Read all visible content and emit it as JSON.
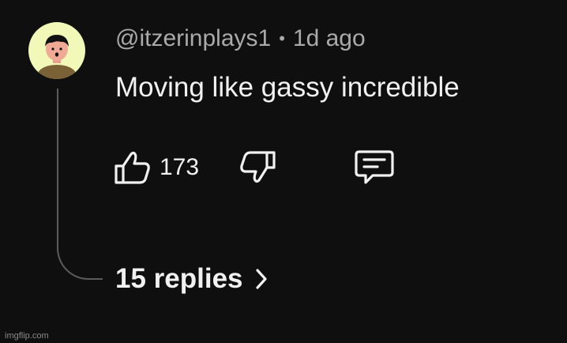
{
  "comment": {
    "handle": "@itzerinplays1",
    "separator": "•",
    "time": "1d ago",
    "text": "Moving like gassy incredible",
    "avatar_bg": "#f2f8b8"
  },
  "actions": {
    "like_icon": "thumbs-up-icon",
    "like_count": "173",
    "dislike_icon": "thumbs-down-icon",
    "reply_icon": "comment-icon"
  },
  "replies": {
    "label": "15 replies",
    "icon": "chevron-right-icon"
  },
  "watermark": "imgflip.com"
}
